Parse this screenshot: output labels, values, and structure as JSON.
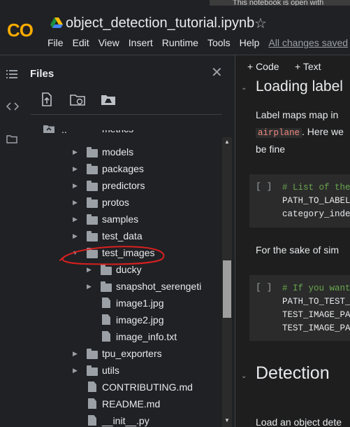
{
  "notice": {
    "text": "This notebook is open with"
  },
  "app": {
    "logo": "CO",
    "notebook_title": "object_detection_tutorial.ipynb",
    "star_icon": "star-outline-icon",
    "menu": [
      "File",
      "Edit",
      "View",
      "Insert",
      "Runtime",
      "Tools",
      "Help"
    ],
    "save_status": "All changes saved"
  },
  "rail": {
    "icons": [
      "toc-icon",
      "code-icon",
      "folder-icon"
    ]
  },
  "files_panel": {
    "title": "Files",
    "close_icon": "close-icon",
    "toolbar": [
      "upload-icon",
      "refresh-folder-icon",
      "mount-drive-icon"
    ],
    "parent_label": "..",
    "items": [
      {
        "name": "metrics",
        "type": "folder",
        "depth": 1,
        "expanded": false
      },
      {
        "name": "models",
        "type": "folder",
        "depth": 1,
        "expanded": false
      },
      {
        "name": "packages",
        "type": "folder",
        "depth": 1,
        "expanded": false
      },
      {
        "name": "predictors",
        "type": "folder",
        "depth": 1,
        "expanded": false
      },
      {
        "name": "protos",
        "type": "folder",
        "depth": 1,
        "expanded": false
      },
      {
        "name": "samples",
        "type": "folder",
        "depth": 1,
        "expanded": false
      },
      {
        "name": "test_data",
        "type": "folder",
        "depth": 1,
        "expanded": false
      },
      {
        "name": "test_images",
        "type": "folder",
        "depth": 1,
        "expanded": true
      },
      {
        "name": "ducky",
        "type": "folder",
        "depth": 2,
        "expanded": false
      },
      {
        "name": "snapshot_serengeti",
        "type": "folder",
        "depth": 2,
        "expanded": false
      },
      {
        "name": "image1.jpg",
        "type": "file",
        "depth": 2
      },
      {
        "name": "image2.jpg",
        "type": "file",
        "depth": 2
      },
      {
        "name": "image_info.txt",
        "type": "file",
        "depth": 2
      },
      {
        "name": "tpu_exporters",
        "type": "folder",
        "depth": 1,
        "expanded": false
      },
      {
        "name": "utils",
        "type": "folder",
        "depth": 1,
        "expanded": false
      },
      {
        "name": "CONTRIBUTING.md",
        "type": "file",
        "depth": 1
      },
      {
        "name": "README.md",
        "type": "file",
        "depth": 1
      },
      {
        "name": "__init__.py",
        "type": "file",
        "depth": 1
      }
    ]
  },
  "notebook": {
    "add_code": "+ Code",
    "add_text": "+ Text",
    "section1_heading": "Loading label",
    "para1_line1": "Label maps map in",
    "para1_code": "airplane",
    "para1_line2_rest": ". Here we",
    "para1_line3": "be fine",
    "cell1": {
      "run": "[ ]",
      "lines": [
        "# List of the",
        "PATH_TO_LABEL",
        "category_inde"
      ]
    },
    "para2": "For the sake of sim",
    "cell2": {
      "run": "[ ]",
      "lines": [
        "# If you want",
        "PATH_TO_TEST_",
        "TEST_IMAGE_PA",
        "TEST_IMAGE_PA"
      ]
    },
    "section2_heading": "Detection",
    "para3": "Load an object dete"
  },
  "colors": {
    "accent_logo": "#f9ab00",
    "annotation_red": "#d92020",
    "comment_green": "#6aa84f"
  }
}
